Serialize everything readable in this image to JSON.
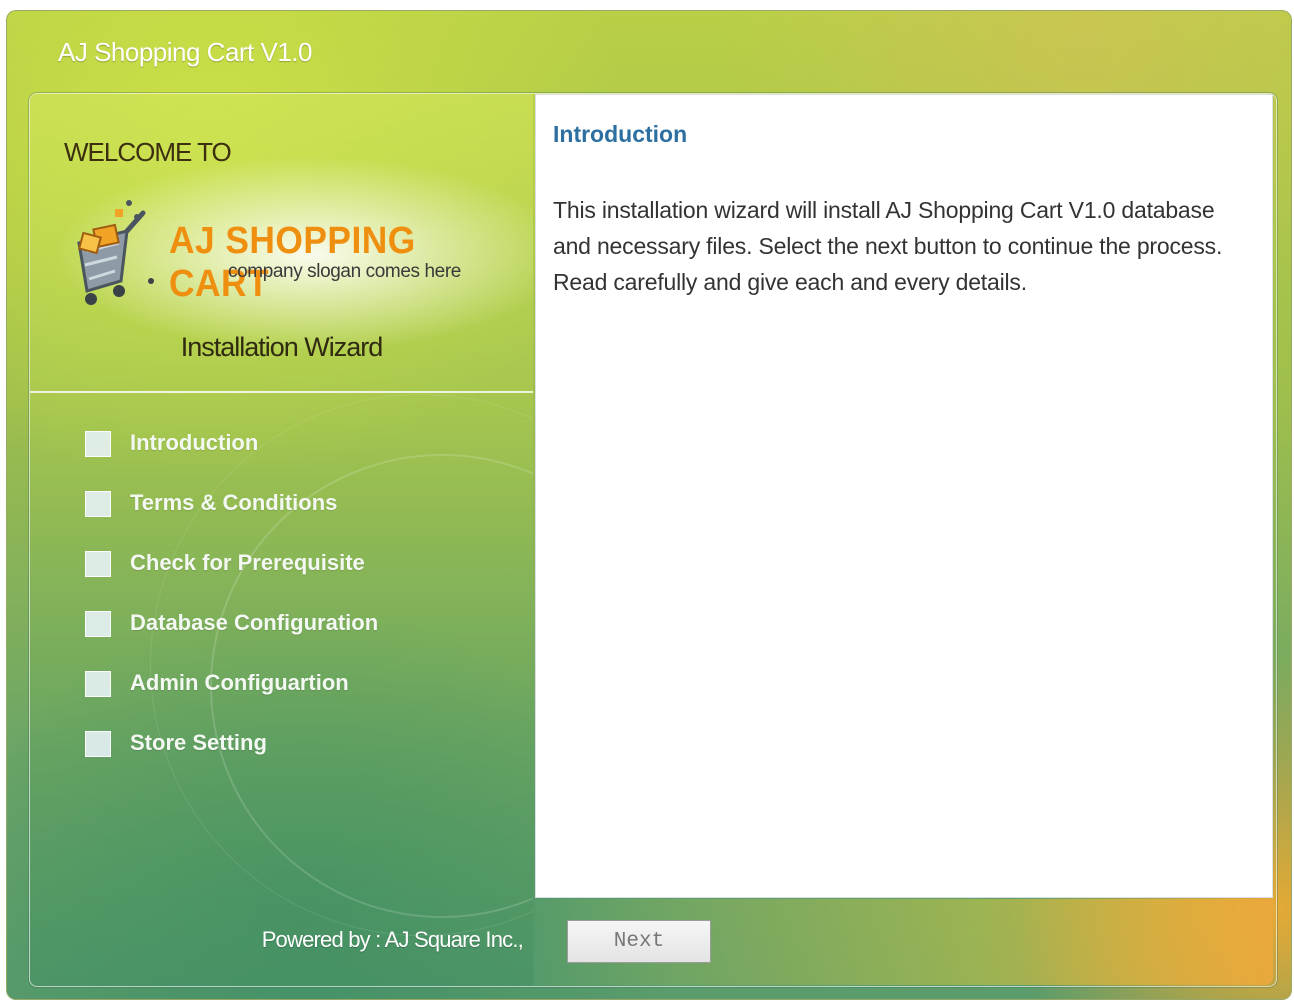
{
  "window": {
    "title": "AJ Shopping Cart V1.0"
  },
  "sidebar": {
    "welcome": "WELCOME TO",
    "brand": "AJ SHOPPING CART",
    "slogan": "company slogan comes here",
    "wizard_title": "Installation Wizard",
    "steps": [
      {
        "label": "Introduction"
      },
      {
        "label": "Terms & Conditions"
      },
      {
        "label": "Check for Prerequisite"
      },
      {
        "label": "Database Configuration"
      },
      {
        "label": "Admin Configuartion"
      },
      {
        "label": "Store Setting"
      }
    ],
    "powered_by": "Powered by : AJ Square Inc.,"
  },
  "content": {
    "title": "Introduction",
    "body": "This installation wizard will install AJ Shopping Cart V1.0 database and necessary files. Select the next button to continue the process. Read carefully and give each and every details."
  },
  "footer": {
    "next_label": "Next"
  },
  "colors": {
    "brand_orange": "#ef8f10",
    "title_blue": "#2c6fa0",
    "frame_green": "#9ebe4d",
    "accent_orange": "#ecaa32"
  }
}
